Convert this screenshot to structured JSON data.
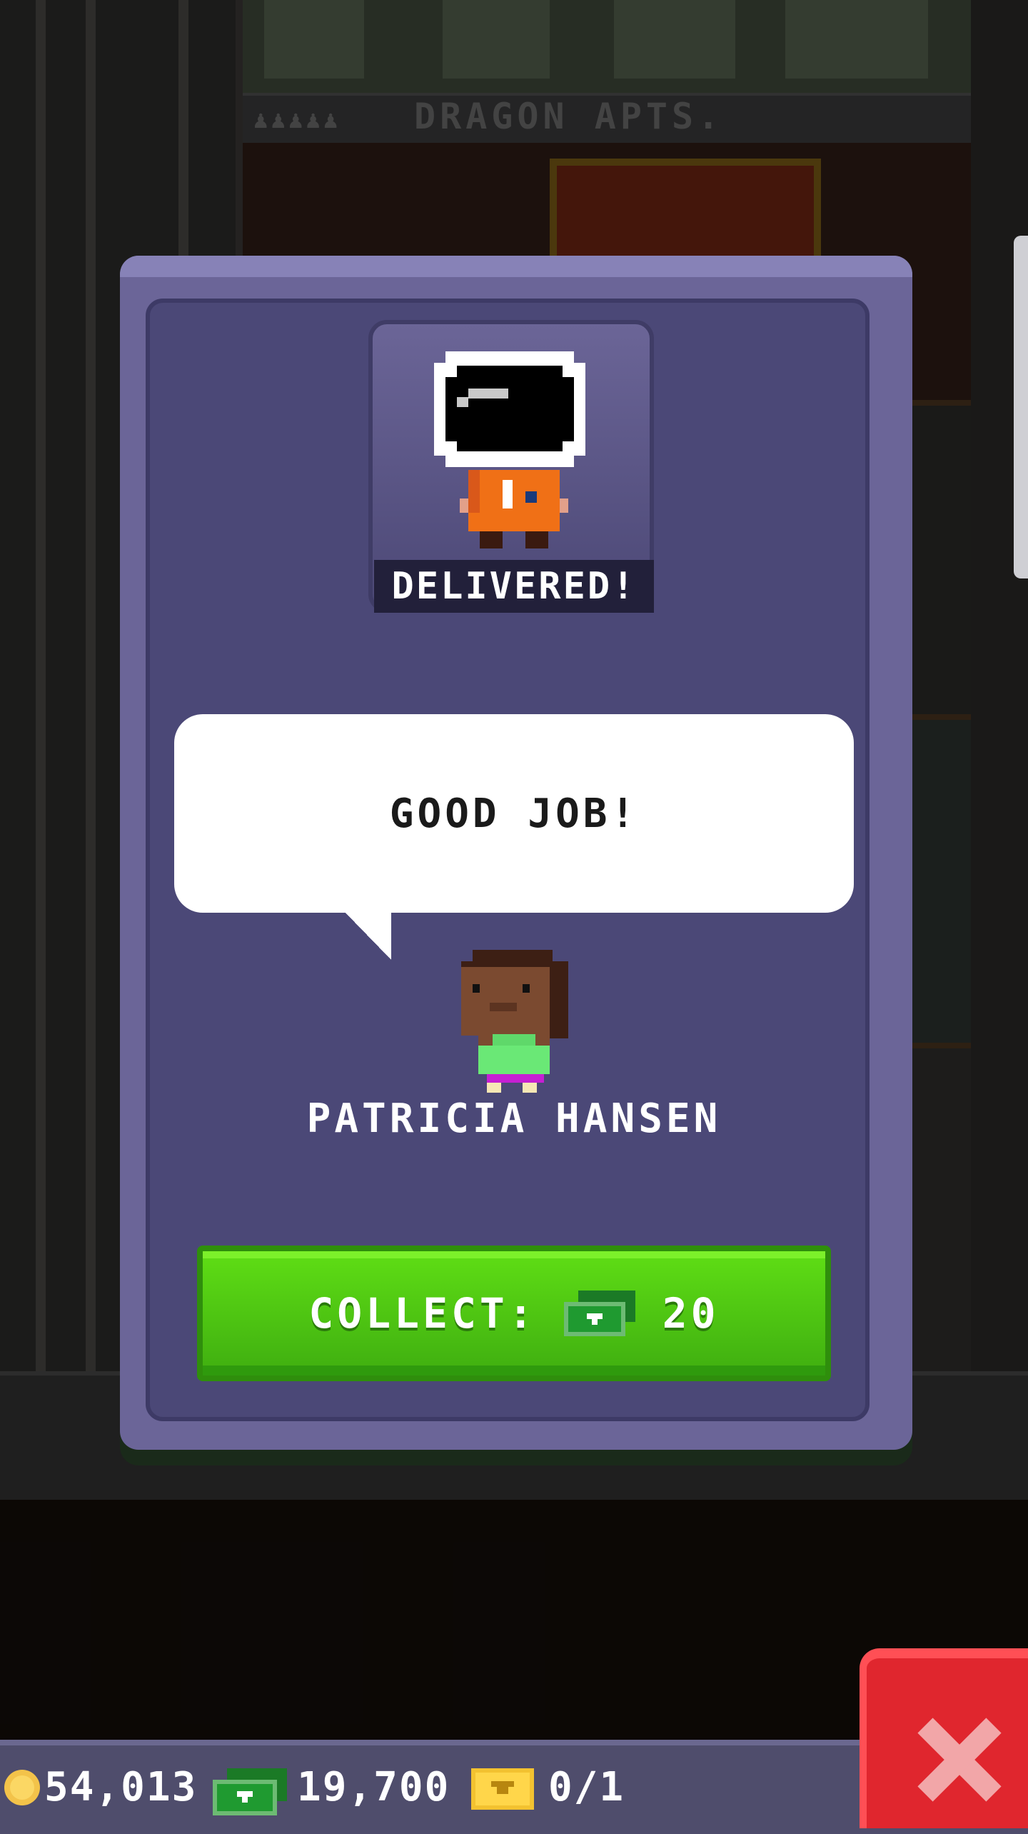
{
  "building": {
    "sign_text": "DRAGON APTS."
  },
  "modal": {
    "status": "DELIVERED!",
    "speech": "GOOD JOB!",
    "recipient_name": "PATRICIA HANSEN",
    "collect_label": "COLLECT:",
    "collect_amount": "20",
    "collect_icon": "bux-icon",
    "status_icon": "astronaut-icon"
  },
  "currency": {
    "coins": "54,013",
    "bux": "19,700",
    "tickets": "0/1",
    "icons": [
      "coin-icon",
      "bux-icon",
      "golden-ticket-icon"
    ]
  },
  "colors": {
    "panel": "#6b6598",
    "panel_inner": "#4b4877",
    "collect_green": "#4fc812",
    "close_red": "#e0262e"
  }
}
